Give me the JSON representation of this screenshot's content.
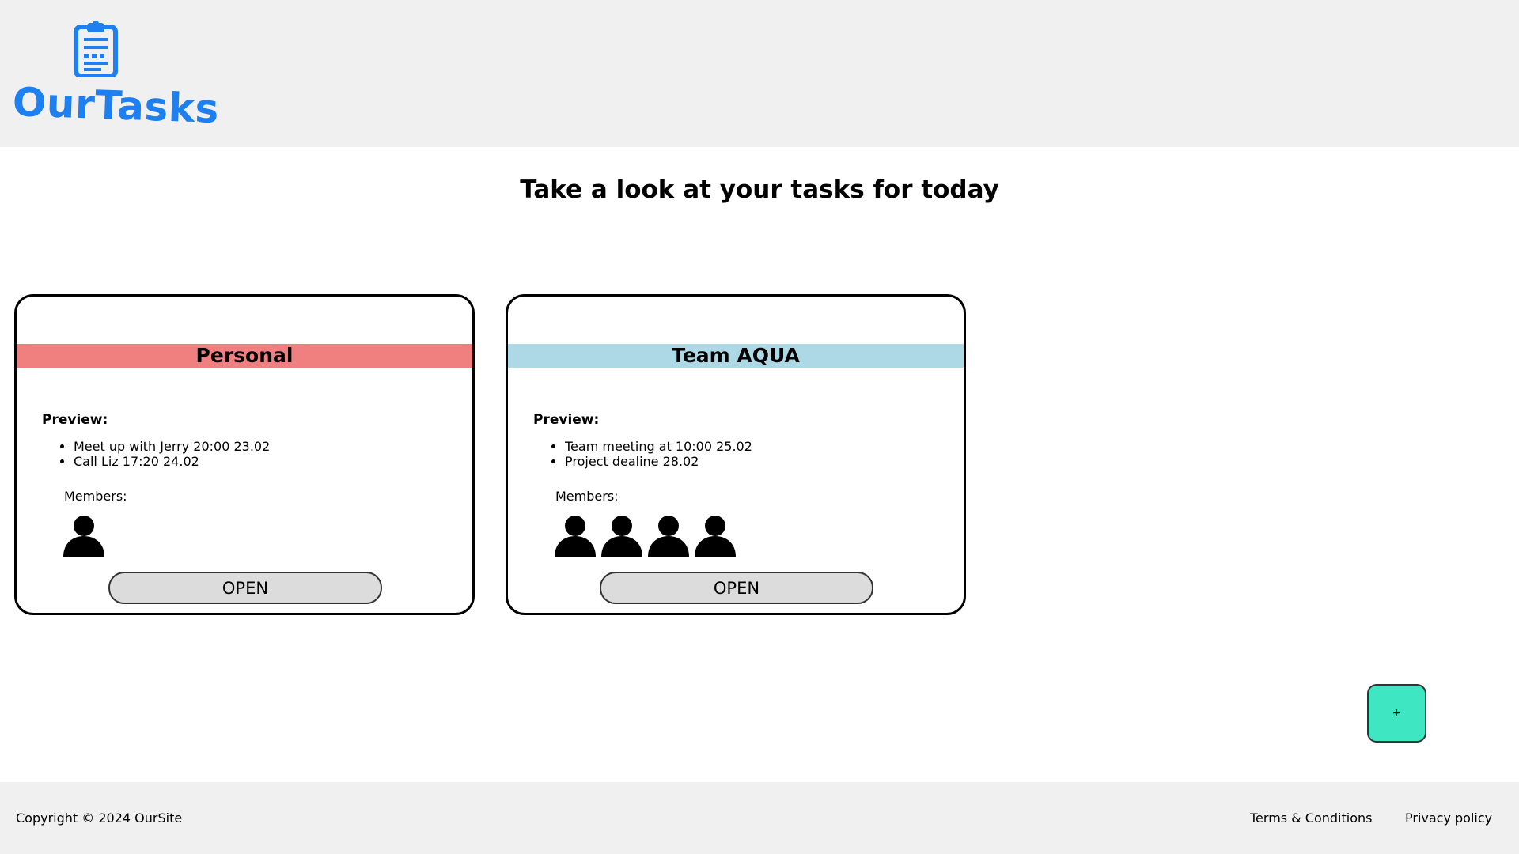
{
  "brand": {
    "name": "OurTasks",
    "icon": "clipboard-icon",
    "color": "#1e7ff0"
  },
  "main": {
    "title": "Take a look at your tasks for today"
  },
  "cards": [
    {
      "title": "Personal",
      "band_color": "#f08080",
      "preview_label": "Preview:",
      "items": [
        "Meet up with Jerry 20:00 23.02",
        "Call Liz 17:20 24.02"
      ],
      "members_label": "Members:",
      "member_icon": "person-icon",
      "member_count": 1,
      "open_label": "OPEN"
    },
    {
      "title": "Team AQUA",
      "band_color": "#add8e6",
      "preview_label": "Preview:",
      "items": [
        "Team meeting at 10:00 25.02",
        "Project dealine 28.02"
      ],
      "members_label": "Members:",
      "member_icon": "person-icon",
      "member_count": 4,
      "open_label": "OPEN"
    }
  ],
  "add_button": {
    "label": "+",
    "color": "#3ee6c2"
  },
  "footer": {
    "copyright": "Copyright © 2024 OurSite",
    "terms": "Terms & Conditions",
    "privacy": "Privacy policy"
  }
}
